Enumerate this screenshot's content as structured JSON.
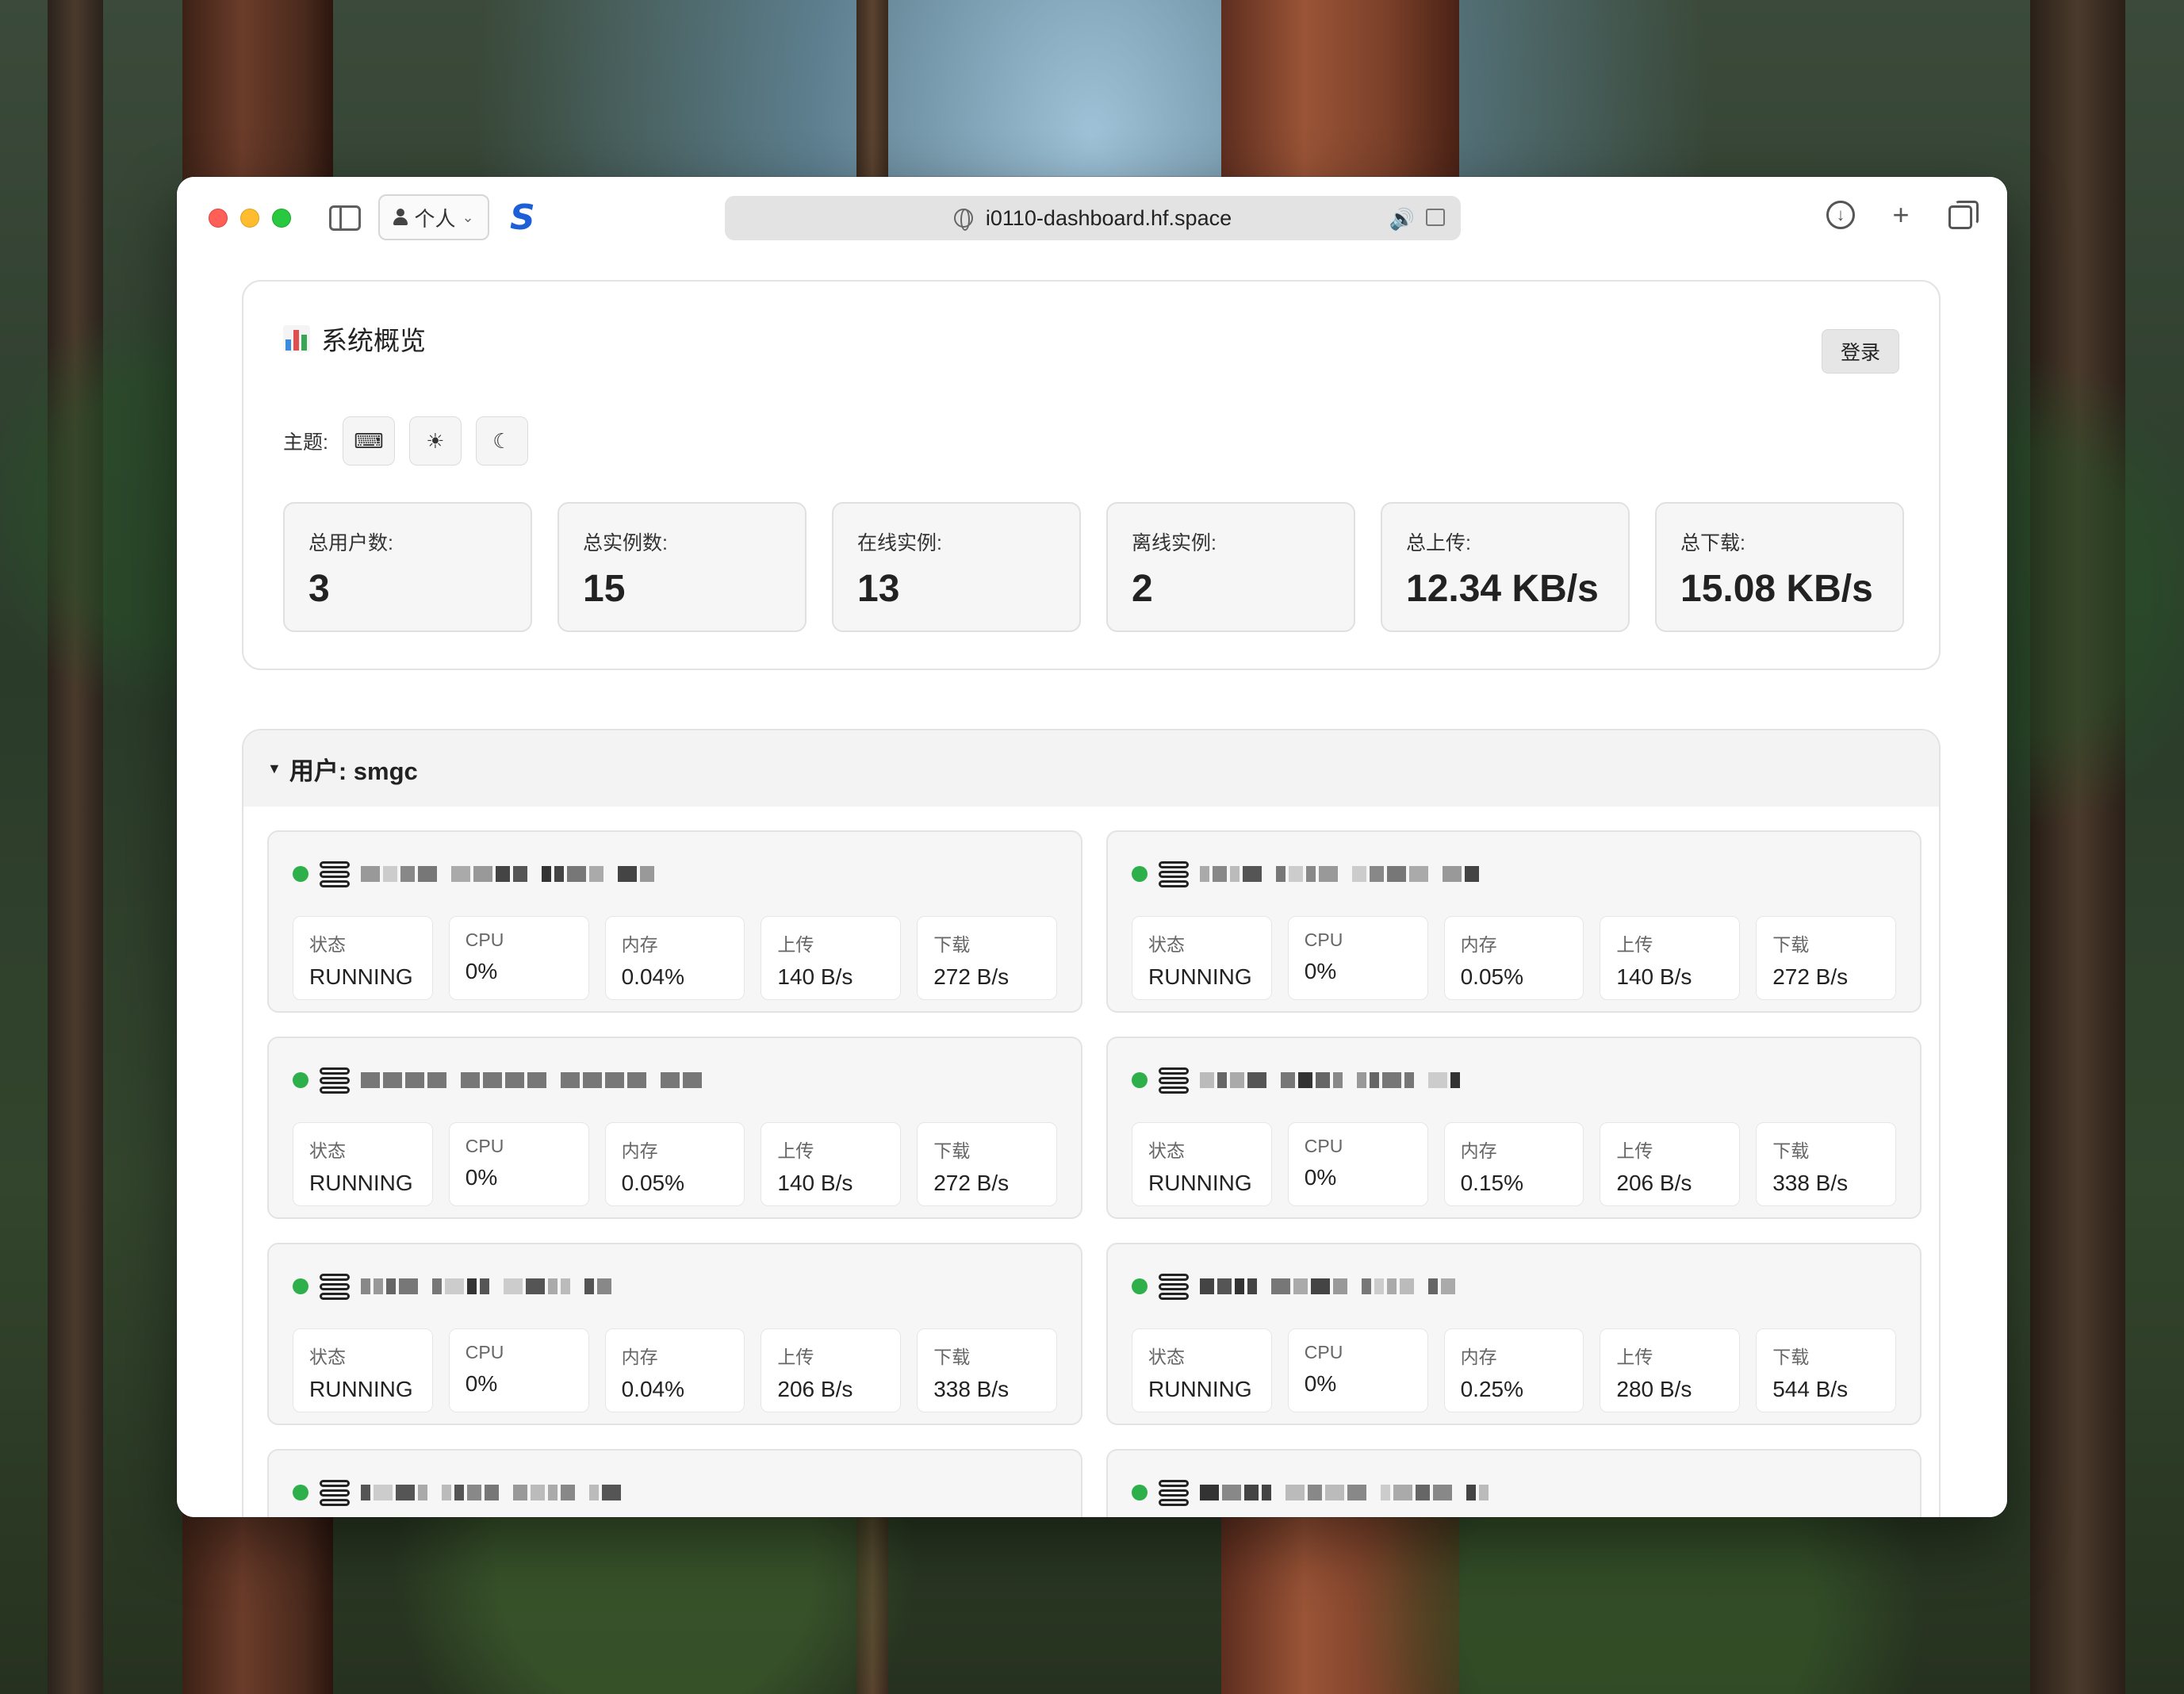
{
  "browser": {
    "profile_label": "个人",
    "url": "i0110-dashboard.hf.space"
  },
  "overview": {
    "title": "系统概览",
    "login_label": "登录",
    "theme_label": "主题:",
    "themes": [
      "system-theme-icon",
      "light-theme-icon",
      "dark-theme-icon"
    ],
    "stats": [
      {
        "label": "总用户数:",
        "value": "3"
      },
      {
        "label": "总实例数:",
        "value": "15"
      },
      {
        "label": "在线实例:",
        "value": "13"
      },
      {
        "label": "离线实例:",
        "value": "2"
      },
      {
        "label": "总上传:",
        "value": "12.34 KB/s"
      },
      {
        "label": "总下载:",
        "value": "15.08 KB/s"
      }
    ]
  },
  "user_section": {
    "title": "用户: smgc",
    "metric_labels": {
      "status": "状态",
      "cpu": "CPU",
      "mem": "内存",
      "up": "上传",
      "down": "下载"
    },
    "instances": [
      {
        "status": "RUNNING",
        "cpu": "0%",
        "mem": "0.04%",
        "up": "140 B/s",
        "down": "272 B/s"
      },
      {
        "status": "RUNNING",
        "cpu": "0%",
        "mem": "0.05%",
        "up": "140 B/s",
        "down": "272 B/s"
      },
      {
        "status": "RUNNING",
        "cpu": "0%",
        "mem": "0.05%",
        "up": "140 B/s",
        "down": "272 B/s"
      },
      {
        "status": "RUNNING",
        "cpu": "0%",
        "mem": "0.15%",
        "up": "206 B/s",
        "down": "338 B/s"
      },
      {
        "status": "RUNNING",
        "cpu": "0%",
        "mem": "0.04%",
        "up": "206 B/s",
        "down": "338 B/s"
      },
      {
        "status": "RUNNING",
        "cpu": "0%",
        "mem": "0.25%",
        "up": "280 B/s",
        "down": "544 B/s"
      }
    ]
  },
  "colors": {
    "accent_blue": "#1d5fd6",
    "online_green": "#2db04a"
  }
}
